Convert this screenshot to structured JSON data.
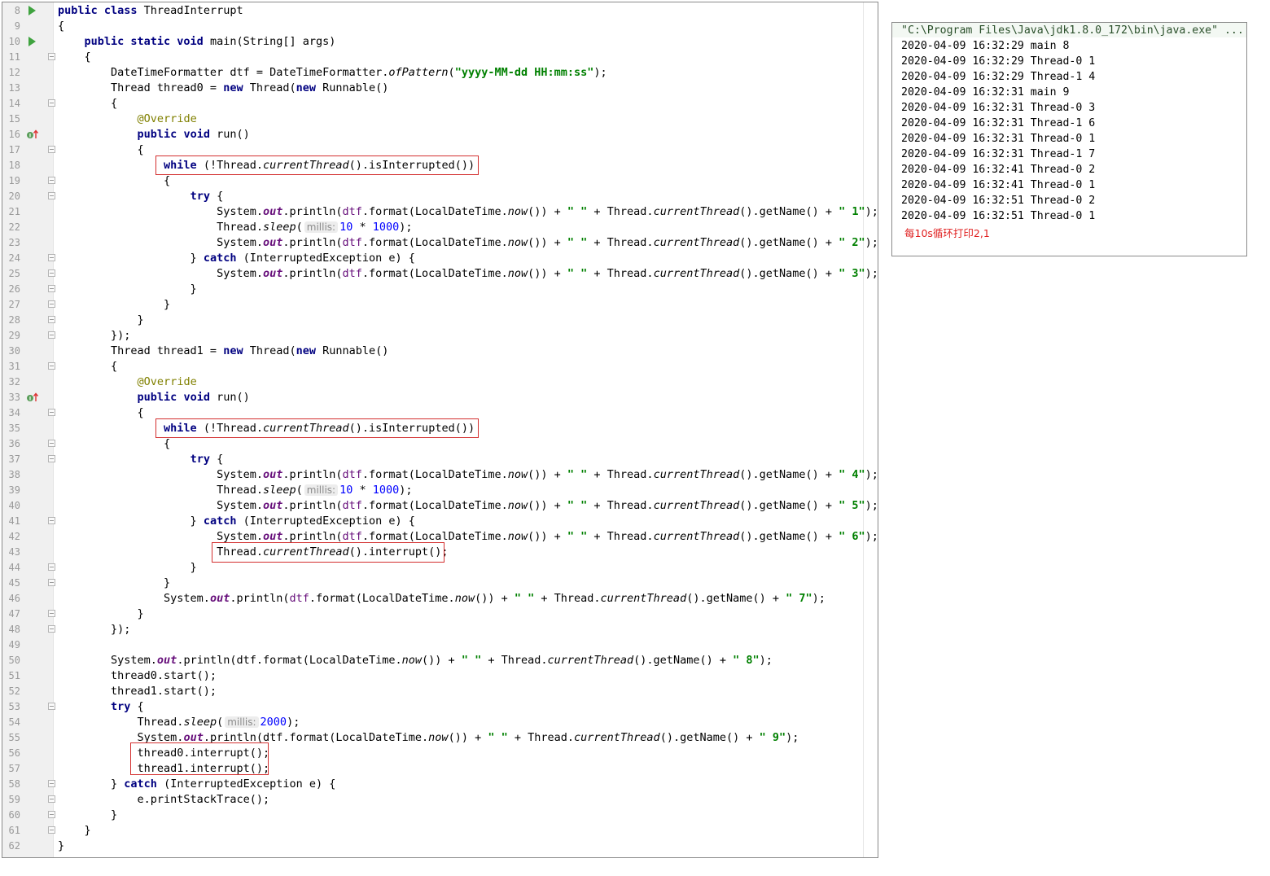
{
  "editor": {
    "first_line_number": 8,
    "run_icon_lines": [
      8,
      10
    ],
    "impl_icon_lines": [
      16,
      33
    ],
    "fold_lines": [
      11,
      14,
      17,
      19,
      20,
      24,
      25,
      26,
      27,
      28,
      29,
      31,
      34,
      36,
      37,
      41,
      44,
      45,
      47,
      48,
      53,
      58,
      59,
      60,
      61
    ],
    "highlight_color": "#d32f2f",
    "lines": [
      [
        [
          "kw",
          "public class "
        ],
        [
          "",
          "ThreadInterrupt"
        ]
      ],
      [
        [
          "",
          "{"
        ]
      ],
      [
        [
          "",
          "    "
        ],
        [
          "kw",
          "public static void "
        ],
        [
          "",
          "main(String[] args)"
        ]
      ],
      [
        [
          "",
          "    {"
        ]
      ],
      [
        [
          "",
          "        DateTimeFormatter dtf = DateTimeFormatter."
        ],
        [
          "st",
          "ofPattern"
        ],
        [
          "",
          "("
        ],
        [
          "str",
          "\"yyyy-MM-dd HH:mm:ss\""
        ],
        [
          "",
          ");"
        ]
      ],
      [
        [
          "",
          "        Thread thread0 = "
        ],
        [
          "kw",
          "new "
        ],
        [
          "",
          "Thread("
        ],
        [
          "kw",
          "new "
        ],
        [
          "",
          "Runnable()"
        ]
      ],
      [
        [
          "",
          "        {"
        ]
      ],
      [
        [
          "",
          "            "
        ],
        [
          "anno",
          "@Override"
        ]
      ],
      [
        [
          "",
          "            "
        ],
        [
          "kw",
          "public void "
        ],
        [
          "",
          "run()"
        ]
      ],
      [
        [
          "",
          "            {"
        ]
      ],
      [
        [
          "",
          "                "
        ],
        [
          "kw",
          "while "
        ],
        [
          "",
          "(!Thread."
        ],
        [
          "st",
          "currentThread"
        ],
        [
          "",
          "().isInterrupted())"
        ]
      ],
      [
        [
          "",
          "                {"
        ]
      ],
      [
        [
          "",
          "                    "
        ],
        [
          "kw",
          "try "
        ],
        [
          "",
          "{"
        ]
      ],
      [
        [
          "",
          "                        System."
        ],
        [
          "fld",
          "out"
        ],
        [
          "",
          ".println("
        ],
        [
          "lv",
          "dtf"
        ],
        [
          "",
          ".format(LocalDateTime."
        ],
        [
          "st",
          "now"
        ],
        [
          "",
          "()) + "
        ],
        [
          "str",
          "\" \""
        ],
        [
          "",
          " + Thread."
        ],
        [
          "st",
          "currentThread"
        ],
        [
          "",
          "().getName() + "
        ],
        [
          "str",
          "\" 1\""
        ],
        [
          "",
          ");"
        ]
      ],
      [
        [
          "",
          "                        Thread."
        ],
        [
          "st",
          "sleep"
        ],
        [
          "",
          "("
        ],
        [
          "hint",
          "millis:"
        ],
        [
          "num",
          "10"
        ],
        [
          "",
          " * "
        ],
        [
          "num",
          "1000"
        ],
        [
          "",
          ");"
        ]
      ],
      [
        [
          "",
          "                        System."
        ],
        [
          "fld",
          "out"
        ],
        [
          "",
          ".println("
        ],
        [
          "lv",
          "dtf"
        ],
        [
          "",
          ".format(LocalDateTime."
        ],
        [
          "st",
          "now"
        ],
        [
          "",
          "()) + "
        ],
        [
          "str",
          "\" \""
        ],
        [
          "",
          " + Thread."
        ],
        [
          "st",
          "currentThread"
        ],
        [
          "",
          "().getName() + "
        ],
        [
          "str",
          "\" 2\""
        ],
        [
          "",
          ");"
        ]
      ],
      [
        [
          "",
          "                    } "
        ],
        [
          "kw",
          "catch "
        ],
        [
          "",
          "(InterruptedException e) {"
        ]
      ],
      [
        [
          "",
          "                        System."
        ],
        [
          "fld",
          "out"
        ],
        [
          "",
          ".println("
        ],
        [
          "lv",
          "dtf"
        ],
        [
          "",
          ".format(LocalDateTime."
        ],
        [
          "st",
          "now"
        ],
        [
          "",
          "()) + "
        ],
        [
          "str",
          "\" \""
        ],
        [
          "",
          " + Thread."
        ],
        [
          "st",
          "currentThread"
        ],
        [
          "",
          "().getName() + "
        ],
        [
          "str",
          "\" 3\""
        ],
        [
          "",
          ");"
        ]
      ],
      [
        [
          "",
          "                    }"
        ]
      ],
      [
        [
          "",
          "                }"
        ]
      ],
      [
        [
          "",
          "            }"
        ]
      ],
      [
        [
          "",
          "        });"
        ]
      ],
      [
        [
          "",
          "        Thread thread1 = "
        ],
        [
          "kw",
          "new "
        ],
        [
          "",
          "Thread("
        ],
        [
          "kw",
          "new "
        ],
        [
          "",
          "Runnable()"
        ]
      ],
      [
        [
          "",
          "        {"
        ]
      ],
      [
        [
          "",
          "            "
        ],
        [
          "anno",
          "@Override"
        ]
      ],
      [
        [
          "",
          "            "
        ],
        [
          "kw",
          "public void "
        ],
        [
          "",
          "run()"
        ]
      ],
      [
        [
          "",
          "            {"
        ]
      ],
      [
        [
          "",
          "                "
        ],
        [
          "kw",
          "while "
        ],
        [
          "",
          "(!Thread."
        ],
        [
          "st",
          "currentThread"
        ],
        [
          "",
          "().isInterrupted())"
        ]
      ],
      [
        [
          "",
          "                {"
        ]
      ],
      [
        [
          "",
          "                    "
        ],
        [
          "kw",
          "try "
        ],
        [
          "",
          "{"
        ]
      ],
      [
        [
          "",
          "                        System."
        ],
        [
          "fld",
          "out"
        ],
        [
          "",
          ".println("
        ],
        [
          "lv",
          "dtf"
        ],
        [
          "",
          ".format(LocalDateTime."
        ],
        [
          "st",
          "now"
        ],
        [
          "",
          "()) + "
        ],
        [
          "str",
          "\" \""
        ],
        [
          "",
          " + Thread."
        ],
        [
          "st",
          "currentThread"
        ],
        [
          "",
          "().getName() + "
        ],
        [
          "str",
          "\" 4\""
        ],
        [
          "",
          ");"
        ]
      ],
      [
        [
          "",
          "                        Thread."
        ],
        [
          "st",
          "sleep"
        ],
        [
          "",
          "("
        ],
        [
          "hint",
          "millis:"
        ],
        [
          "num",
          "10"
        ],
        [
          "",
          " * "
        ],
        [
          "num",
          "1000"
        ],
        [
          "",
          ");"
        ]
      ],
      [
        [
          "",
          "                        System."
        ],
        [
          "fld",
          "out"
        ],
        [
          "",
          ".println("
        ],
        [
          "lv",
          "dtf"
        ],
        [
          "",
          ".format(LocalDateTime."
        ],
        [
          "st",
          "now"
        ],
        [
          "",
          "()) + "
        ],
        [
          "str",
          "\" \""
        ],
        [
          "",
          " + Thread."
        ],
        [
          "st",
          "currentThread"
        ],
        [
          "",
          "().getName() + "
        ],
        [
          "str",
          "\" 5\""
        ],
        [
          "",
          ");"
        ]
      ],
      [
        [
          "",
          "                    } "
        ],
        [
          "kw",
          "catch "
        ],
        [
          "",
          "(InterruptedException e) {"
        ]
      ],
      [
        [
          "",
          "                        System."
        ],
        [
          "fld",
          "out"
        ],
        [
          "",
          ".println("
        ],
        [
          "lv",
          "dtf"
        ],
        [
          "",
          ".format(LocalDateTime."
        ],
        [
          "st",
          "now"
        ],
        [
          "",
          "()) + "
        ],
        [
          "str",
          "\" \""
        ],
        [
          "",
          " + Thread."
        ],
        [
          "st",
          "currentThread"
        ],
        [
          "",
          "().getName() + "
        ],
        [
          "str",
          "\" 6\""
        ],
        [
          "",
          ");"
        ]
      ],
      [
        [
          "",
          "                        Thread."
        ],
        [
          "st",
          "currentThread"
        ],
        [
          "",
          "().interrupt();"
        ]
      ],
      [
        [
          "",
          "                    }"
        ]
      ],
      [
        [
          "",
          "                }"
        ]
      ],
      [
        [
          "",
          "                System."
        ],
        [
          "fld",
          "out"
        ],
        [
          "",
          ".println("
        ],
        [
          "lv",
          "dtf"
        ],
        [
          "",
          ".format(LocalDateTime."
        ],
        [
          "st",
          "now"
        ],
        [
          "",
          "()) + "
        ],
        [
          "str",
          "\" \""
        ],
        [
          "",
          " + Thread."
        ],
        [
          "st",
          "currentThread"
        ],
        [
          "",
          "().getName() + "
        ],
        [
          "str",
          "\" 7\""
        ],
        [
          "",
          ");"
        ]
      ],
      [
        [
          "",
          "            }"
        ]
      ],
      [
        [
          "",
          "        });"
        ]
      ],
      [
        [
          "",
          ""
        ]
      ],
      [
        [
          "",
          "        System."
        ],
        [
          "fld",
          "out"
        ],
        [
          "",
          ".println(dtf.format(LocalDateTime."
        ],
        [
          "st",
          "now"
        ],
        [
          "",
          "()) + "
        ],
        [
          "str",
          "\" \""
        ],
        [
          "",
          " + Thread."
        ],
        [
          "st",
          "currentThread"
        ],
        [
          "",
          "().getName() + "
        ],
        [
          "str",
          "\" 8\""
        ],
        [
          "",
          ");"
        ]
      ],
      [
        [
          "",
          "        thread0.start();"
        ]
      ],
      [
        [
          "",
          "        thread1.start();"
        ]
      ],
      [
        [
          "",
          "        "
        ],
        [
          "kw",
          "try "
        ],
        [
          "",
          "{"
        ]
      ],
      [
        [
          "",
          "            Thread."
        ],
        [
          "st",
          "sleep"
        ],
        [
          "",
          "("
        ],
        [
          "hint",
          "millis:"
        ],
        [
          "num",
          "2000"
        ],
        [
          "",
          ");"
        ]
      ],
      [
        [
          "",
          "            System."
        ],
        [
          "fld",
          "out"
        ],
        [
          "",
          ".println(dtf.format(LocalDateTime."
        ],
        [
          "st",
          "now"
        ],
        [
          "",
          "()) + "
        ],
        [
          "str",
          "\" \""
        ],
        [
          "",
          " + Thread."
        ],
        [
          "st",
          "currentThread"
        ],
        [
          "",
          "().getName() + "
        ],
        [
          "str",
          "\" 9\""
        ],
        [
          "",
          ");"
        ]
      ],
      [
        [
          "",
          "            thread0.interrupt();"
        ]
      ],
      [
        [
          "",
          "            thread1.interrupt();"
        ]
      ],
      [
        [
          "",
          "        } "
        ],
        [
          "kw",
          "catch "
        ],
        [
          "",
          "(InterruptedException e) {"
        ]
      ],
      [
        [
          "",
          "            e.printStackTrace();"
        ]
      ],
      [
        [
          "",
          "        }"
        ]
      ],
      [
        [
          "",
          "    }"
        ]
      ],
      [
        [
          "",
          "}"
        ]
      ]
    ]
  },
  "console": {
    "command": "\"C:\\Program Files\\Java\\jdk1.8.0_172\\bin\\java.exe\" ...",
    "output": [
      "2020-04-09 16:32:29 main 8",
      "2020-04-09 16:32:29 Thread-0 1",
      "2020-04-09 16:32:29 Thread-1 4",
      "2020-04-09 16:32:31 main 9",
      "2020-04-09 16:32:31 Thread-0 3",
      "2020-04-09 16:32:31 Thread-1 6",
      "2020-04-09 16:32:31 Thread-0 1",
      "2020-04-09 16:32:31 Thread-1 7",
      "2020-04-09 16:32:41 Thread-0 2",
      "2020-04-09 16:32:41 Thread-0 1",
      "2020-04-09 16:32:51 Thread-0 2",
      "2020-04-09 16:32:51 Thread-0 1"
    ],
    "annotation": "每10s循环打印2,1"
  }
}
